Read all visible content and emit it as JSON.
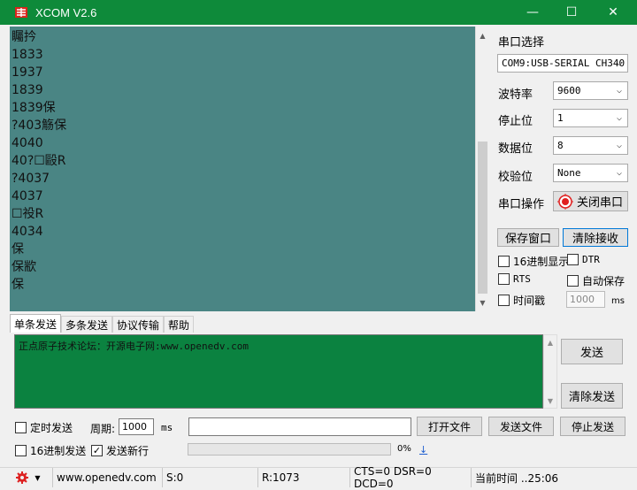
{
  "window": {
    "title": "XCOM V2.6",
    "minimize": "—",
    "maximize": "☐",
    "close": "✕"
  },
  "receive": {
    "lines": [
      "矚扲",
      "1833",
      "1937",
      "1839",
      "1839保",
      "?403觞保",
      "4040",
      "40?☐毆R",
      "?4037",
      "4037",
      "☐祋R",
      "4034",
      "保",
      "保歂",
      "保"
    ]
  },
  "serial": {
    "port_select_label": "串口选择",
    "port_value": "COM9:USB-SERIAL CH340",
    "baud_label": "波特率",
    "baud_value": "9600",
    "stopbit_label": "停止位",
    "stopbit_value": "1",
    "databit_label": "数据位",
    "databit_value": "8",
    "parity_label": "校验位",
    "parity_value": "None",
    "op_label": "串口操作",
    "op_button": "关闭串口",
    "save_button": "保存窗口",
    "clear_recv_button": "清除接收",
    "hex_display": "16进制显示",
    "dtr": "DTR",
    "rts": "RTS",
    "auto_save": "自动保存",
    "timestamp": "时间戳",
    "timestamp_value": "1000",
    "timestamp_unit": "ms"
  },
  "tabs": [
    "单条发送",
    "多条发送",
    "协议传输",
    "帮助"
  ],
  "send": {
    "text": "正点原子技术论坛：开源电子网:www.openedv.com",
    "send_button": "发送",
    "clear_button": "清除发送"
  },
  "bottom": {
    "timed_send": "定时发送",
    "period_label": "周期:",
    "period_value": "1000",
    "period_unit": "ms",
    "open_file": "打开文件",
    "send_file": "发送文件",
    "stop_send": "停止发送",
    "hex_send": "16进制发送",
    "send_newline": "发送新行",
    "progress_pct": "0%",
    "link": "↓"
  },
  "status": {
    "url": "www.openedv.com",
    "sent": "S:0",
    "recv": "R:1073",
    "signals": "CTS=0 DSR=0 DCD=0",
    "time": "当前时间 ..25:06"
  }
}
